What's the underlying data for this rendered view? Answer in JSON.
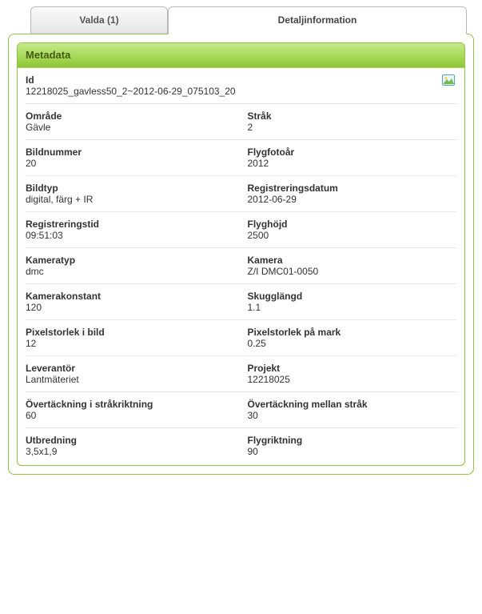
{
  "tabs": {
    "inactive_label": "Valda (1)",
    "active_label": "Detaljinformation"
  },
  "card": {
    "title": "Metadata"
  },
  "meta": {
    "id": {
      "label": "Id",
      "value": "12218025_gavless50_2~2012-06-29_075103_20"
    },
    "rows": [
      {
        "left": {
          "label": "Område",
          "value": "Gävle"
        },
        "right": {
          "label": "Stråk",
          "value": "2"
        }
      },
      {
        "left": {
          "label": "Bildnummer",
          "value": "20"
        },
        "right": {
          "label": "Flygfotoår",
          "value": "2012"
        }
      },
      {
        "left": {
          "label": "Bildtyp",
          "value": "digital, färg + IR"
        },
        "right": {
          "label": "Registreringsdatum",
          "value": "2012-06-29"
        }
      },
      {
        "left": {
          "label": "Registreringstid",
          "value": "09:51:03"
        },
        "right": {
          "label": "Flyghöjd",
          "value": "2500"
        }
      },
      {
        "left": {
          "label": "Kameratyp",
          "value": "dmc"
        },
        "right": {
          "label": "Kamera",
          "value": "Z/I DMC01-0050"
        }
      },
      {
        "left": {
          "label": "Kamerakonstant",
          "value": "120"
        },
        "right": {
          "label": "Skugglängd",
          "value": "1.1"
        }
      },
      {
        "left": {
          "label": "Pixelstorlek i bild",
          "value": "12"
        },
        "right": {
          "label": "Pixelstorlek på mark",
          "value": "0.25"
        }
      },
      {
        "left": {
          "label": "Leverantör",
          "value": "Lantmäteriet"
        },
        "right": {
          "label": "Projekt",
          "value": "12218025"
        }
      },
      {
        "left": {
          "label": "Övertäckning i stråkriktning",
          "value": "60"
        },
        "right": {
          "label": "Övertäckning mellan stråk",
          "value": "30"
        }
      },
      {
        "left": {
          "label": "Utbredning",
          "value": "3,5x1,9"
        },
        "right": {
          "label": "Flygriktning",
          "value": "90"
        }
      }
    ]
  }
}
